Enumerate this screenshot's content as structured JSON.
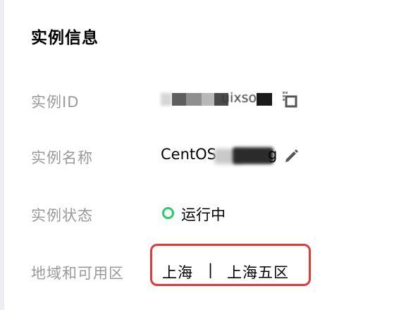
{
  "section": {
    "title": "实例信息"
  },
  "instance_id": {
    "label": "实例ID",
    "value_visible_tail": "uixsoo",
    "copy_icon": "copy-icon"
  },
  "instance_name": {
    "label": "实例名称",
    "value_prefix": "CentOS",
    "value_suffix": "g",
    "edit_icon": "pencil-icon"
  },
  "instance_status": {
    "label": "实例状态",
    "value": "运行中",
    "status_color": "#29cc6a"
  },
  "region_zone": {
    "label": "地域和可用区",
    "region": "上海",
    "separator": "|",
    "zone": "上海五区",
    "highlight_color": "#e53935"
  }
}
